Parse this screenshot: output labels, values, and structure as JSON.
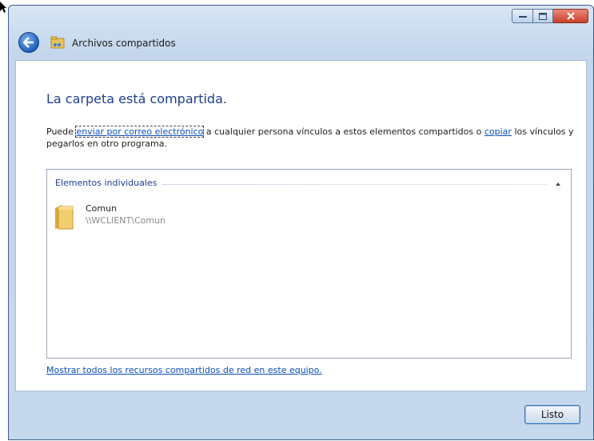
{
  "window": {
    "nav_title": "Archivos compartidos",
    "close_color": "#c8412a"
  },
  "content": {
    "heading": "La carpeta está compartida.",
    "description": {
      "part1": "Puede ",
      "link_email": "enviar por correo electrónico",
      "part2": " a cualquier persona vínculos a estos elementos compartidos o ",
      "link_copy": "copiar",
      "part3": " los vínculos y pegarlos en otro programa."
    },
    "group": {
      "label": "Elementos individuales",
      "items": [
        {
          "name": "Comun",
          "path": "\\\\WCLIENT\\Comun",
          "icon": "folder-icon"
        }
      ]
    },
    "show_all_link": "Mostrar todos los recursos compartidos de red en este equipo."
  },
  "footer": {
    "done_button": "Listo"
  },
  "colors": {
    "heading": "#1e3f8f",
    "link": "#0a4fbf",
    "frame": "#c3d6ec"
  }
}
